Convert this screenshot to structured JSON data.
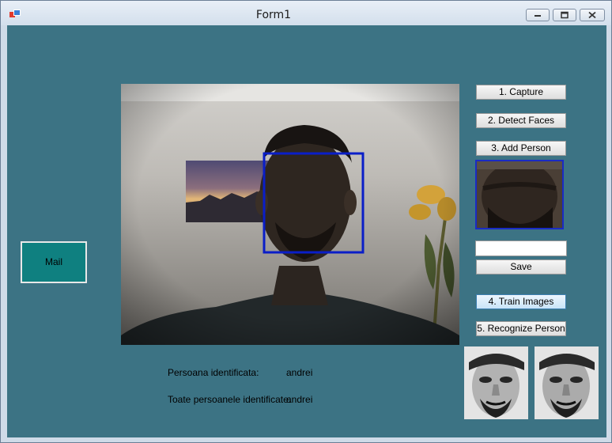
{
  "window": {
    "title": "Form1"
  },
  "controls": {
    "capture": "1. Capture",
    "detect": "2. Detect Faces",
    "add_person": "3. Add Person",
    "save": "Save",
    "train": "4. Train Images",
    "recognize": "5. Recognize Person",
    "mail": "Mail",
    "name_input": ""
  },
  "results": {
    "identified_label": "Persoana identificata:",
    "identified_value": "andrei",
    "all_label": "Toate persoanele identificate:",
    "all_value": "andrei"
  },
  "colors": {
    "form_background": "#3c7384",
    "mail_button": "#0f8080",
    "face_box": "#0a1ec8"
  }
}
